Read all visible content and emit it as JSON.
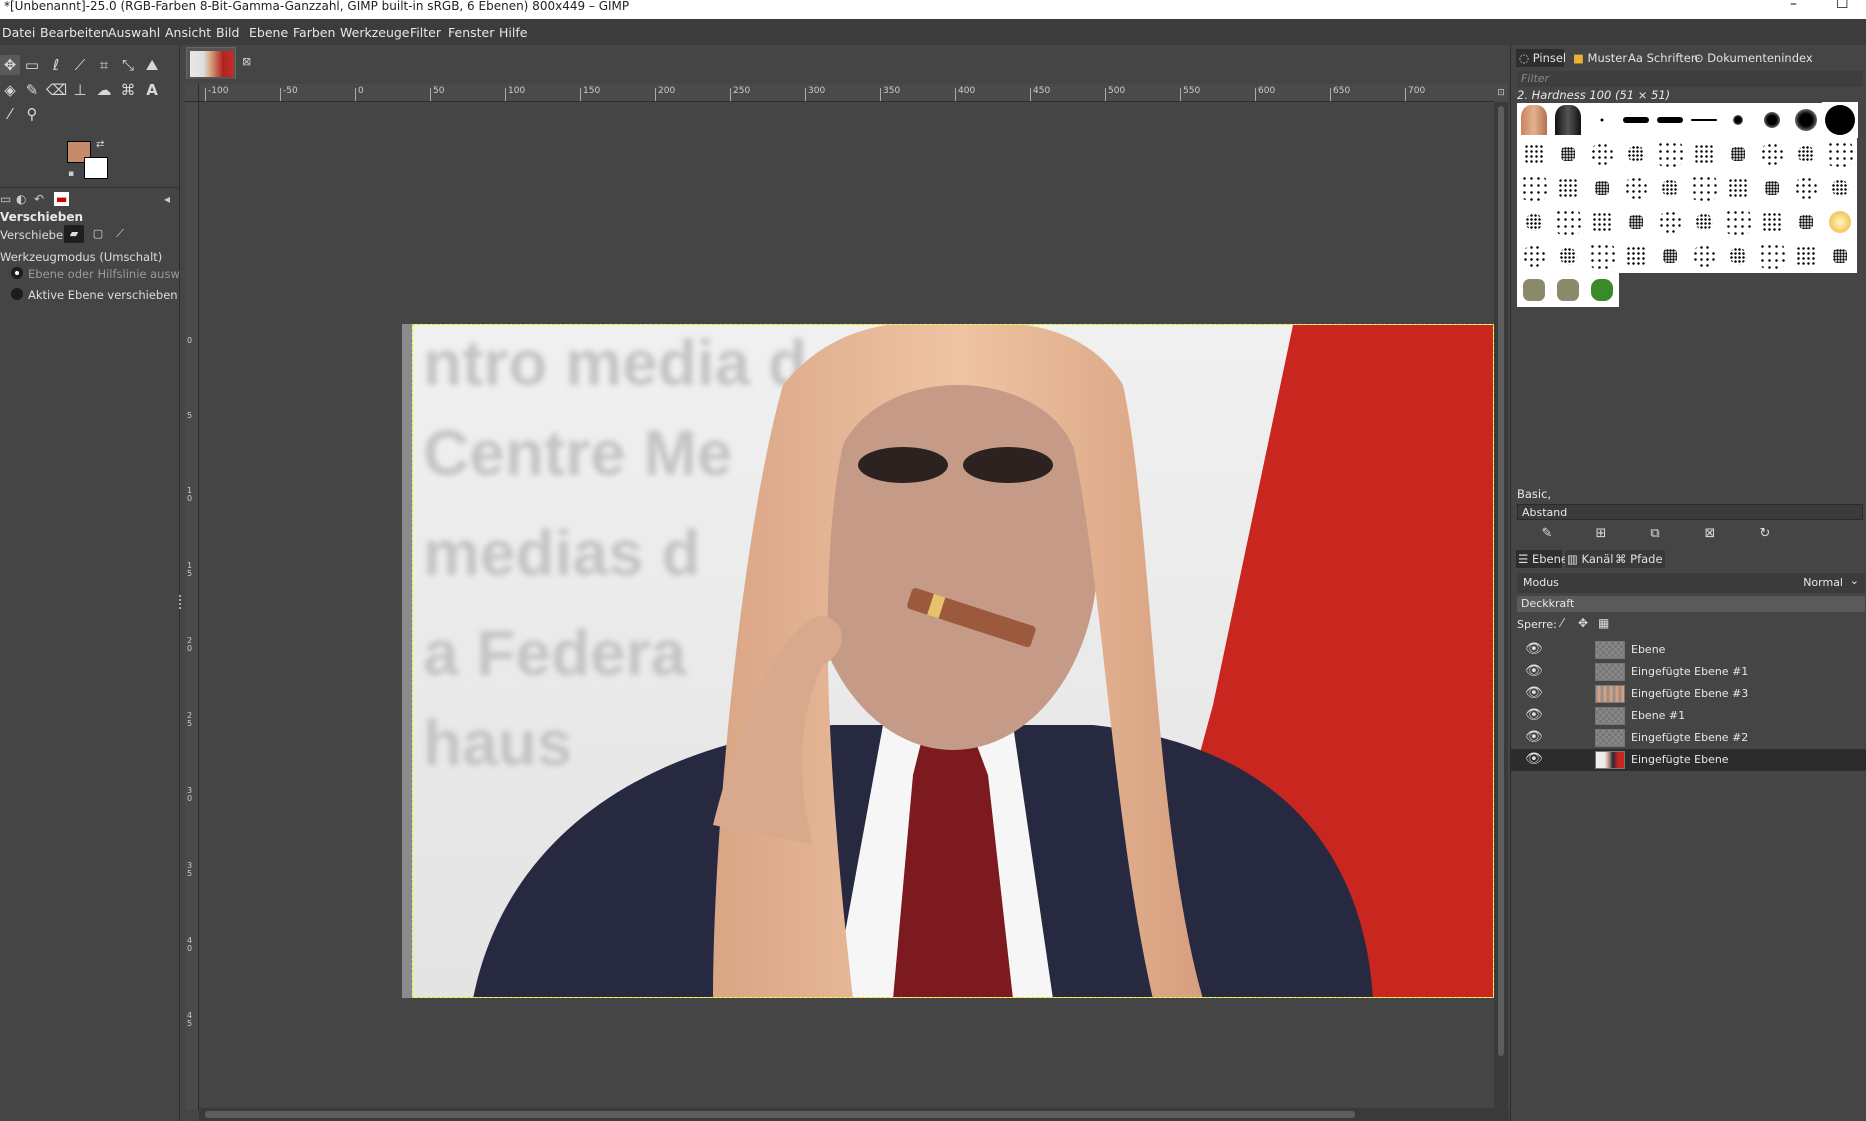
{
  "window": {
    "title": "*[Unbenannt]-25.0 (RGB-Farben 8-Bit-Gamma-Ganzzahl, GIMP built-in sRGB, 6 Ebenen) 800x449 – GIMP",
    "minimize": "–",
    "maximize": "☐"
  },
  "menu": [
    "Datei",
    "Bearbeiten",
    "Auswahl",
    "Ansicht",
    "Bild",
    "Ebene",
    "Farben",
    "Werkzeuge",
    "Filter",
    "Fenster",
    "Hilfe"
  ],
  "toolbox": {
    "tool_options_title": "Verschieben",
    "move_label": "Verschieben:",
    "mode_label": "Werkzeugmodus (Umschalt)",
    "radio_1": "Ebene oder Hilfslinie auswählen",
    "radio_2": "Aktive Ebene verschieben",
    "fg_color": "#c48c6a",
    "bg_color": "#ffffff"
  },
  "ruler": {
    "top": [
      "-100",
      "-50",
      "0",
      "50",
      "100",
      "150",
      "200",
      "250",
      "300",
      "350",
      "400",
      "450",
      "500",
      "550",
      "600",
      "650",
      "700"
    ],
    "left": [
      "0",
      "5",
      "10",
      "15",
      "20",
      "25",
      "30",
      "35",
      "40",
      "45"
    ]
  },
  "dock": {
    "tabs": [
      "Pinsel",
      "Muster",
      "Schriften",
      "Dokumentenindex"
    ],
    "filter_placeholder": "Filter",
    "brush_name": "2. Hardness 100 (51 × 51)",
    "brush_preset": "Basic,",
    "spacing_label": "Abstand",
    "layer_tabs": [
      "Ebenen",
      "Kanäle",
      "Pfade"
    ],
    "mode_label": "Modus",
    "mode_value": "Normal",
    "opacity_label": "Deckkraft",
    "lock_label": "Sperre:",
    "layers": [
      {
        "name": "Ebene",
        "selected": false
      },
      {
        "name": "Eingefügte Ebene #1",
        "selected": false
      },
      {
        "name": "Eingefügte Ebene #3",
        "selected": false
      },
      {
        "name": "Ebene #1",
        "selected": false
      },
      {
        "name": "Eingefügte Ebene #2",
        "selected": false
      },
      {
        "name": "Eingefügte Ebene",
        "selected": true
      }
    ]
  }
}
